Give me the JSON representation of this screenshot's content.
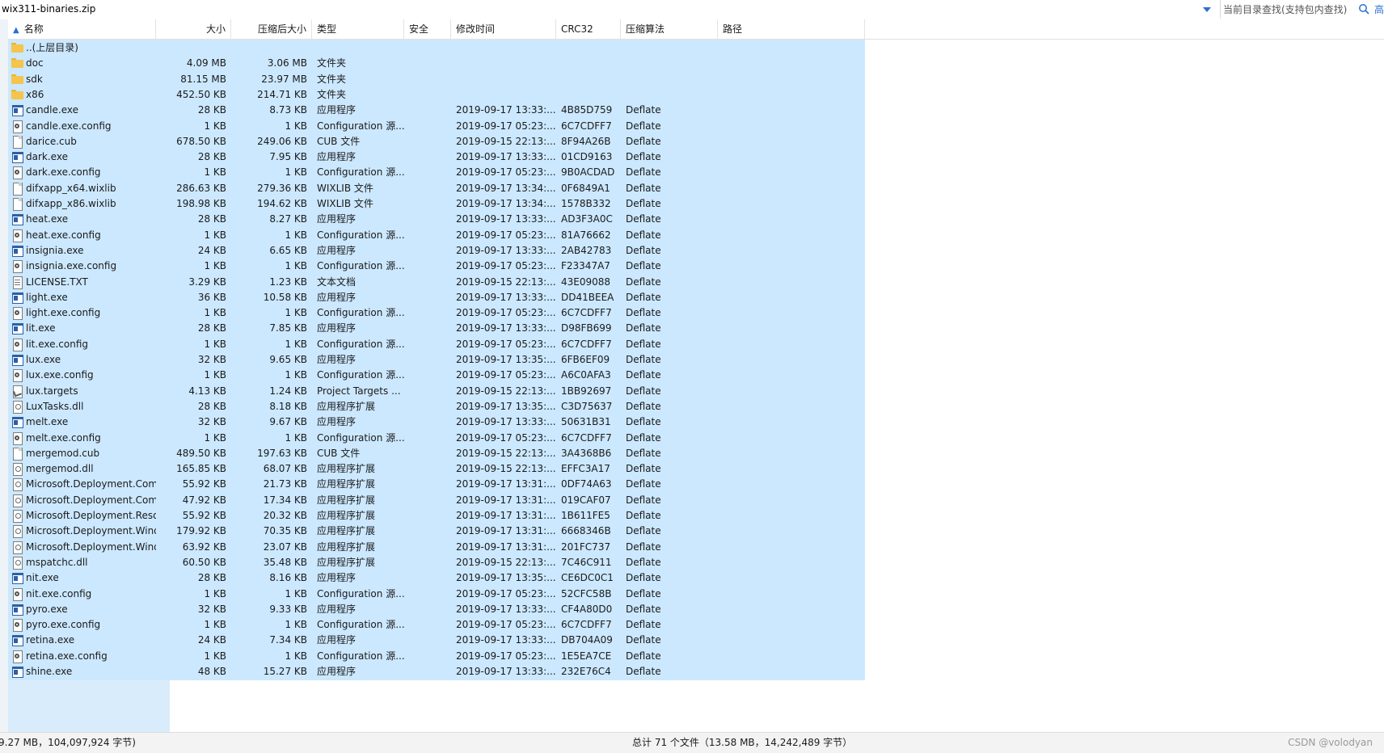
{
  "address": {
    "path": "wix311-binaries.zip"
  },
  "search": {
    "placeholder": "当前目录查找(支持包内查找)",
    "edge_glyph": "高"
  },
  "columns": {
    "name": "名称",
    "size": "大小",
    "packed": "压缩后大小",
    "type": "类型",
    "security": "安全",
    "modified": "修改时间",
    "crc": "CRC32",
    "method": "压缩算法",
    "path": "路径"
  },
  "rows": [
    {
      "icon": "folder",
      "name": "..(上层目录)",
      "size": "",
      "packed": "",
      "type": "",
      "modified": "",
      "crc": "",
      "method": ""
    },
    {
      "icon": "folder",
      "name": "doc",
      "size": "4.09 MB",
      "packed": "3.06 MB",
      "type": "文件夹",
      "modified": "",
      "crc": "",
      "method": ""
    },
    {
      "icon": "folder",
      "name": "sdk",
      "size": "81.15 MB",
      "packed": "23.97 MB",
      "type": "文件夹",
      "modified": "",
      "crc": "",
      "method": ""
    },
    {
      "icon": "folder",
      "name": "x86",
      "size": "452.50 KB",
      "packed": "214.71 KB",
      "type": "文件夹",
      "modified": "",
      "crc": "",
      "method": ""
    },
    {
      "icon": "exe",
      "name": "candle.exe",
      "size": "28 KB",
      "packed": "8.73 KB",
      "type": "应用程序",
      "modified": "2019-09-17 13:33:...",
      "crc": "4B85D759",
      "method": "Deflate"
    },
    {
      "icon": "cfg",
      "name": "candle.exe.config",
      "size": "1 KB",
      "packed": "1 KB",
      "type": "Configuration 源...",
      "modified": "2019-09-17 05:23:...",
      "crc": "6C7CDFF7",
      "method": "Deflate"
    },
    {
      "icon": "doc",
      "name": "darice.cub",
      "size": "678.50 KB",
      "packed": "249.06 KB",
      "type": "CUB 文件",
      "modified": "2019-09-15 22:13:...",
      "crc": "8F94A26B",
      "method": "Deflate"
    },
    {
      "icon": "exe",
      "name": "dark.exe",
      "size": "28 KB",
      "packed": "7.95 KB",
      "type": "应用程序",
      "modified": "2019-09-17 13:33:...",
      "crc": "01CD9163",
      "method": "Deflate"
    },
    {
      "icon": "cfg",
      "name": "dark.exe.config",
      "size": "1 KB",
      "packed": "1 KB",
      "type": "Configuration 源...",
      "modified": "2019-09-17 05:23:...",
      "crc": "9B0ACDAD",
      "method": "Deflate"
    },
    {
      "icon": "doc",
      "name": "difxapp_x64.wixlib",
      "size": "286.63 KB",
      "packed": "279.36 KB",
      "type": "WIXLIB 文件",
      "modified": "2019-09-17 13:34:...",
      "crc": "0F6849A1",
      "method": "Deflate"
    },
    {
      "icon": "doc",
      "name": "difxapp_x86.wixlib",
      "size": "198.98 KB",
      "packed": "194.62 KB",
      "type": "WIXLIB 文件",
      "modified": "2019-09-17 13:34:...",
      "crc": "1578B332",
      "method": "Deflate"
    },
    {
      "icon": "exe",
      "name": "heat.exe",
      "size": "28 KB",
      "packed": "8.27 KB",
      "type": "应用程序",
      "modified": "2019-09-17 13:33:...",
      "crc": "AD3F3A0C",
      "method": "Deflate"
    },
    {
      "icon": "cfg",
      "name": "heat.exe.config",
      "size": "1 KB",
      "packed": "1 KB",
      "type": "Configuration 源...",
      "modified": "2019-09-17 05:23:...",
      "crc": "81A76662",
      "method": "Deflate"
    },
    {
      "icon": "exe",
      "name": "insignia.exe",
      "size": "24 KB",
      "packed": "6.65 KB",
      "type": "应用程序",
      "modified": "2019-09-17 13:33:...",
      "crc": "2AB42783",
      "method": "Deflate"
    },
    {
      "icon": "cfg",
      "name": "insignia.exe.config",
      "size": "1 KB",
      "packed": "1 KB",
      "type": "Configuration 源...",
      "modified": "2019-09-17 05:23:...",
      "crc": "F23347A7",
      "method": "Deflate"
    },
    {
      "icon": "txt",
      "name": "LICENSE.TXT",
      "size": "3.29 KB",
      "packed": "1.23 KB",
      "type": "文本文档",
      "modified": "2019-09-15 22:13:...",
      "crc": "43E09088",
      "method": "Deflate"
    },
    {
      "icon": "exe",
      "name": "light.exe",
      "size": "36 KB",
      "packed": "10.58 KB",
      "type": "应用程序",
      "modified": "2019-09-17 13:33:...",
      "crc": "DD41BEEA",
      "method": "Deflate"
    },
    {
      "icon": "cfg",
      "name": "light.exe.config",
      "size": "1 KB",
      "packed": "1 KB",
      "type": "Configuration 源...",
      "modified": "2019-09-17 05:23:...",
      "crc": "6C7CDFF7",
      "method": "Deflate"
    },
    {
      "icon": "exe",
      "name": "lit.exe",
      "size": "28 KB",
      "packed": "7.85 KB",
      "type": "应用程序",
      "modified": "2019-09-17 13:33:...",
      "crc": "D98FB699",
      "method": "Deflate"
    },
    {
      "icon": "cfg",
      "name": "lit.exe.config",
      "size": "1 KB",
      "packed": "1 KB",
      "type": "Configuration 源...",
      "modified": "2019-09-17 05:23:...",
      "crc": "6C7CDFF7",
      "method": "Deflate"
    },
    {
      "icon": "exe",
      "name": "lux.exe",
      "size": "32 KB",
      "packed": "9.65 KB",
      "type": "应用程序",
      "modified": "2019-09-17 13:35:...",
      "crc": "6FB6EF09",
      "method": "Deflate"
    },
    {
      "icon": "cfg",
      "name": "lux.exe.config",
      "size": "1 KB",
      "packed": "1 KB",
      "type": "Configuration 源...",
      "modified": "2019-09-17 05:23:...",
      "crc": "A6C0AFA3",
      "method": "Deflate"
    },
    {
      "icon": "tgt",
      "name": "lux.targets",
      "size": "4.13 KB",
      "packed": "1.24 KB",
      "type": "Project Targets ...",
      "modified": "2019-09-15 22:13:...",
      "crc": "1BB92697",
      "method": "Deflate"
    },
    {
      "icon": "dll",
      "name": "LuxTasks.dll",
      "size": "28 KB",
      "packed": "8.18 KB",
      "type": "应用程序扩展",
      "modified": "2019-09-17 13:35:...",
      "crc": "C3D75637",
      "method": "Deflate"
    },
    {
      "icon": "exe",
      "name": "melt.exe",
      "size": "32 KB",
      "packed": "9.67 KB",
      "type": "应用程序",
      "modified": "2019-09-17 13:33:...",
      "crc": "50631B31",
      "method": "Deflate"
    },
    {
      "icon": "cfg",
      "name": "melt.exe.config",
      "size": "1 KB",
      "packed": "1 KB",
      "type": "Configuration 源...",
      "modified": "2019-09-17 05:23:...",
      "crc": "6C7CDFF7",
      "method": "Deflate"
    },
    {
      "icon": "doc",
      "name": "mergemod.cub",
      "size": "489.50 KB",
      "packed": "197.63 KB",
      "type": "CUB 文件",
      "modified": "2019-09-15 22:13:...",
      "crc": "3A4368B6",
      "method": "Deflate"
    },
    {
      "icon": "dll",
      "name": "mergemod.dll",
      "size": "165.85 KB",
      "packed": "68.07 KB",
      "type": "应用程序扩展",
      "modified": "2019-09-15 22:13:...",
      "crc": "EFFC3A17",
      "method": "Deflate"
    },
    {
      "icon": "dll",
      "name": "Microsoft.Deployment.Com...",
      "size": "55.92 KB",
      "packed": "21.73 KB",
      "type": "应用程序扩展",
      "modified": "2019-09-17 13:31:...",
      "crc": "0DF74A63",
      "method": "Deflate"
    },
    {
      "icon": "dll",
      "name": "Microsoft.Deployment.Com...",
      "size": "47.92 KB",
      "packed": "17.34 KB",
      "type": "应用程序扩展",
      "modified": "2019-09-17 13:31:...",
      "crc": "019CAF07",
      "method": "Deflate"
    },
    {
      "icon": "dll",
      "name": "Microsoft.Deployment.Reso...",
      "size": "55.92 KB",
      "packed": "20.32 KB",
      "type": "应用程序扩展",
      "modified": "2019-09-17 13:31:...",
      "crc": "1B611FE5",
      "method": "Deflate"
    },
    {
      "icon": "dll",
      "name": "Microsoft.Deployment.Wind...",
      "size": "179.92 KB",
      "packed": "70.35 KB",
      "type": "应用程序扩展",
      "modified": "2019-09-17 13:31:...",
      "crc": "6668346B",
      "method": "Deflate"
    },
    {
      "icon": "dll",
      "name": "Microsoft.Deployment.Wind...",
      "size": "63.92 KB",
      "packed": "23.07 KB",
      "type": "应用程序扩展",
      "modified": "2019-09-17 13:31:...",
      "crc": "201FC737",
      "method": "Deflate"
    },
    {
      "icon": "dll",
      "name": "mspatchc.dll",
      "size": "60.50 KB",
      "packed": "35.48 KB",
      "type": "应用程序扩展",
      "modified": "2019-09-15 22:13:...",
      "crc": "7C46C911",
      "method": "Deflate"
    },
    {
      "icon": "exe",
      "name": "nit.exe",
      "size": "28 KB",
      "packed": "8.16 KB",
      "type": "应用程序",
      "modified": "2019-09-17 13:35:...",
      "crc": "CE6DC0C1",
      "method": "Deflate"
    },
    {
      "icon": "cfg",
      "name": "nit.exe.config",
      "size": "1 KB",
      "packed": "1 KB",
      "type": "Configuration 源...",
      "modified": "2019-09-17 05:23:...",
      "crc": "52CFC58B",
      "method": "Deflate"
    },
    {
      "icon": "exe",
      "name": "pyro.exe",
      "size": "32 KB",
      "packed": "9.33 KB",
      "type": "应用程序",
      "modified": "2019-09-17 13:33:...",
      "crc": "CF4A80D0",
      "method": "Deflate"
    },
    {
      "icon": "cfg",
      "name": "pyro.exe.config",
      "size": "1 KB",
      "packed": "1 KB",
      "type": "Configuration 源...",
      "modified": "2019-09-17 05:23:...",
      "crc": "6C7CDFF7",
      "method": "Deflate"
    },
    {
      "icon": "exe",
      "name": "retina.exe",
      "size": "24 KB",
      "packed": "7.34 KB",
      "type": "应用程序",
      "modified": "2019-09-17 13:33:...",
      "crc": "DB704A09",
      "method": "Deflate"
    },
    {
      "icon": "cfg",
      "name": "retina.exe.config",
      "size": "1 KB",
      "packed": "1 KB",
      "type": "Configuration 源...",
      "modified": "2019-09-17 05:23:...",
      "crc": "1E5EA7CE",
      "method": "Deflate"
    },
    {
      "icon": "exe",
      "name": "shine.exe",
      "size": "48 KB",
      "packed": "15.27 KB",
      "type": "应用程序",
      "modified": "2019-09-17 13:33:...",
      "crc": "232E76C4",
      "method": "Deflate"
    }
  ],
  "status": {
    "left": "9.27 MB，104,097,924 字节)",
    "center": "总计 71 个文件（13.58 MB，14,242,489 字节）",
    "watermark": "CSDN @volodyan"
  },
  "colors": {
    "selection": "#cce8ff",
    "accent": "#2b6fd6"
  }
}
